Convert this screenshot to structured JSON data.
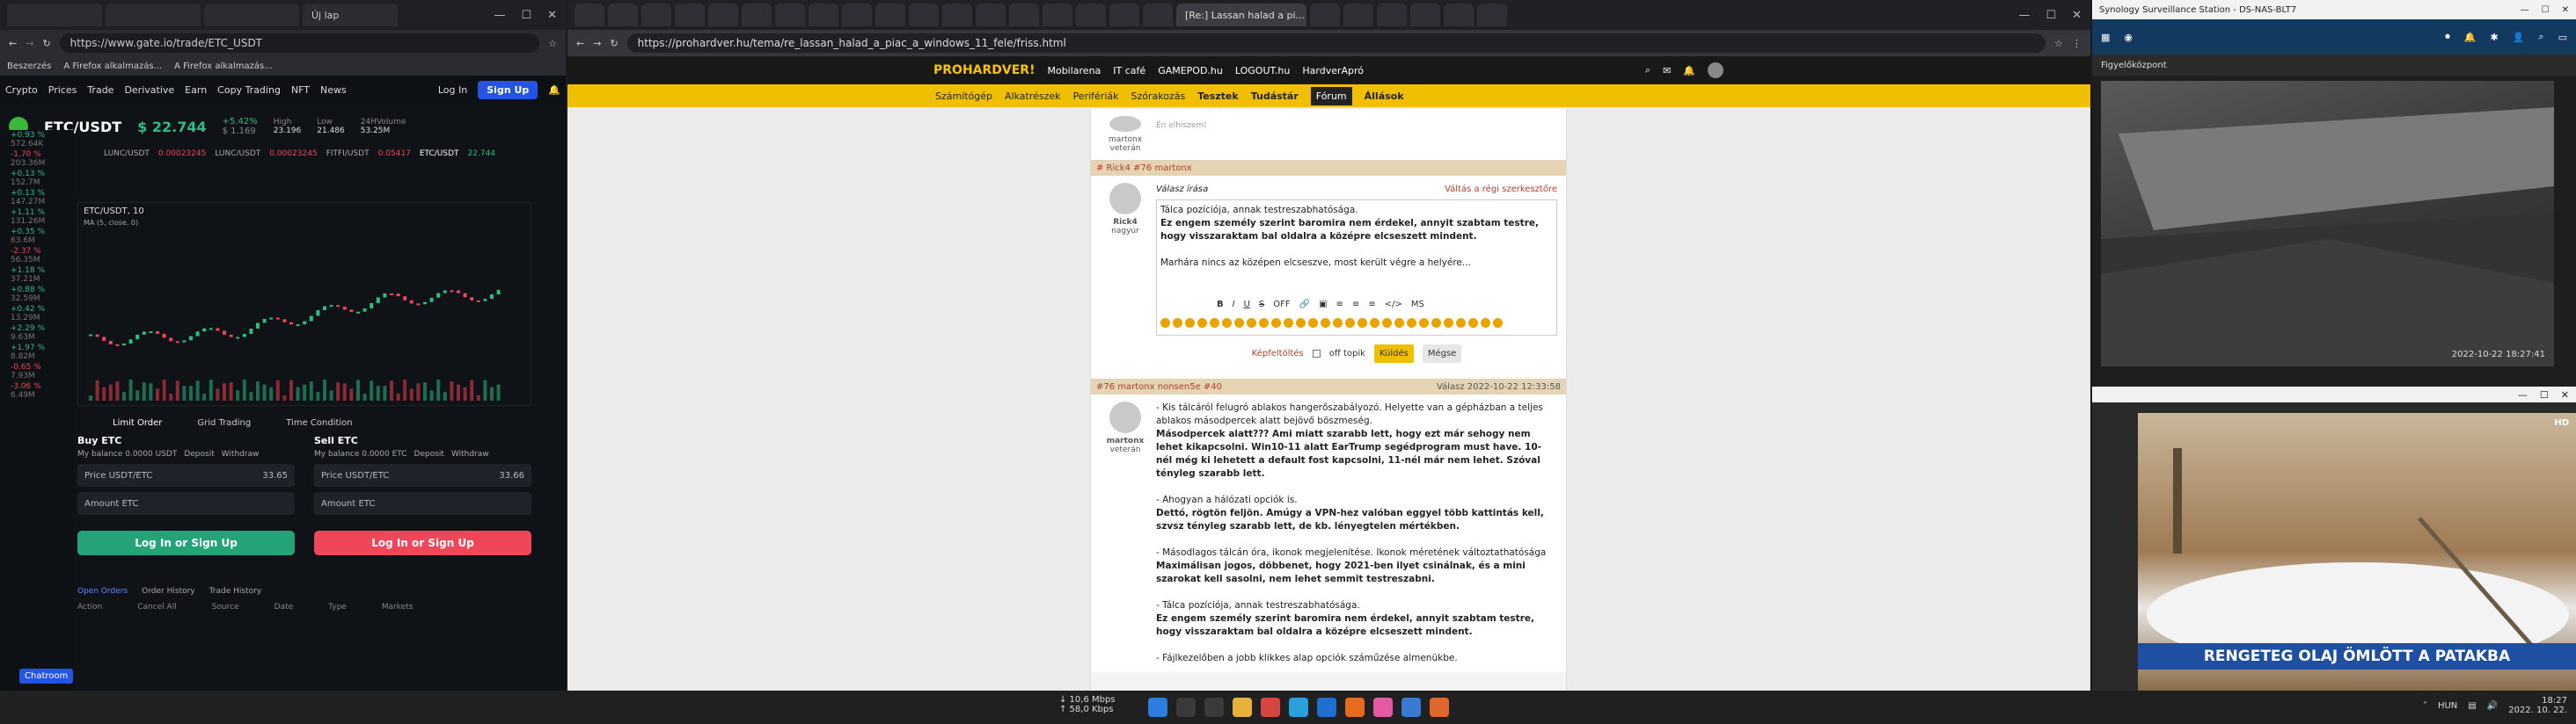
{
  "gate": {
    "tabs": [
      "",
      "",
      "",
      "Új lap",
      "",
      ""
    ],
    "url": "https://www.gate.io/trade/ETC_USDT",
    "bookmarks": [
      "Beszerzés",
      "A Firefox alkalmazás...",
      "A Firefox alkalmazás..."
    ],
    "nav": [
      "Crypto",
      "Prices",
      "Trade",
      "Derivative",
      "Earn",
      "Copy Trading",
      "NFT",
      "News"
    ],
    "login": "Log In",
    "signup": "Sign Up",
    "pair": "ETC/USDT",
    "price": "$ 22.744",
    "change": "+5.42%",
    "price_usd": "$ 1.169",
    "high_label": "High",
    "high": "23.196",
    "low_label": "Low",
    "low": "21.486",
    "vol_label": "24HVolume",
    "vol": "53.25M",
    "subtabs": [
      "LUNC/USDT",
      "0.00023245",
      "LUNC/USDT",
      "0.00023245",
      "FITFI/USDT",
      "0.05417",
      "ETC/USDT",
      "22.744"
    ],
    "chart_title": "ETC/USDT, 10",
    "ma": "MA (5, close, 0)",
    "buy_title": "Buy ETC",
    "sell_title": "Sell ETC",
    "balance_buy": "My balance 0.0000 USDT",
    "balance_sell": "My balance 0.0000 ETC",
    "deposit": "Deposit",
    "withdraw": "Withdraw",
    "price_field": "Price USDT/ETC",
    "price_val": "33.65",
    "price_val_sell": "33.66",
    "amount_field": "Amount ETC",
    "login_or_signup": "Log In or Sign Up",
    "limit_order": "Limit Order",
    "grid_trading": "Grid Trading",
    "time_condition": "Time Condition",
    "open_orders": "Open Orders",
    "order_history": "Order History",
    "trade_history": "Trade History",
    "cols": [
      "Action",
      "Cancel All",
      "Source",
      "Date",
      "Type",
      "Markets"
    ],
    "chatroom": "Chatroom",
    "left_list": [
      {
        "name": "+0.93 %",
        "vol": "572.64K"
      },
      {
        "name": "-1.70 %",
        "vol": "203.36M"
      },
      {
        "name": "+0.13 %",
        "vol": "152.7M"
      },
      {
        "name": "+0.13 %",
        "vol": "147.27M"
      },
      {
        "name": "+1.11 %",
        "vol": "131.26M"
      },
      {
        "name": "+0.35 %",
        "vol": "63.6M"
      },
      {
        "name": "-2.37 %",
        "vol": "56.35M"
      },
      {
        "name": "+1.18 %",
        "vol": "37.21M"
      },
      {
        "name": "+0.88 %",
        "vol": "32.59M"
      },
      {
        "name": "+0.42 %",
        "vol": "13.29M"
      },
      {
        "name": "+2.29 %",
        "vol": "9.63M"
      },
      {
        "name": "+1.97 %",
        "vol": "8.82M"
      },
      {
        "name": "-0.65 %",
        "vol": "7.93M"
      },
      {
        "name": "-3.06 %",
        "vol": "6.49M"
      }
    ]
  },
  "ph": {
    "active_tab": "[Re:] Lassan halad a pi...",
    "url": "https://prohardver.hu/tema/re_lassan_halad_a_piac_a_windows_11_fele/friss.html",
    "logo": "PROHARDVER!",
    "topnav": [
      "Mobilarena",
      "IT café",
      "GAMEPOD.hu",
      "LOGOUT.hu",
      "HardverApró"
    ],
    "nav": [
      "Számítógép",
      "Alkatrészek",
      "Perifériák",
      "Szórakozás",
      "Tesztek",
      "Tudástár",
      "Fórum",
      "Állások"
    ],
    "prev_user": "martonx",
    "prev_rank": "veterán",
    "prev_text": "Én elhiszem!",
    "reply_bar": "# Rick4   #76 martonx",
    "reply_label": "Válasz írása",
    "editor_switch": "Váltás a régi szerkesztőre",
    "reply_user": "Rick4",
    "reply_rank": "nagyúr",
    "reply_lines": [
      "Tálca pozíciója, annak testreszabhatósága.",
      "Ez engem személy szerint baromira nem érdekel, annyit szabtam testre, hogy visszaraktam bal oldalra a középre elcseszett mindent.",
      "",
      "Marhára nincs az középen elcseszve, most került végre a helyére..."
    ],
    "toolbar": [
      "B",
      "I",
      "U",
      "S",
      "OFF",
      "MS"
    ],
    "upload": "Képfeltöltés",
    "offtopic": "off topik",
    "send": "Küldés",
    "cancel": "Mégse",
    "post_bar": "#76 martonx   nonsen5e #40",
    "post_meta": "Válasz   2022-10-22 12:33:58",
    "post_user": "martonx",
    "post_rank": "veterán",
    "post_lines": [
      {
        "t": "- Kis tálcáról felugró ablakos hangerőszabályozó. Helyette van a gépházban a teljes ablakos másodpercek alatt bejövő böszmeség.",
        "b": false
      },
      {
        "t": "Másodpercek alatt??? Ami miatt szarabb lett, hogy ezt már sehogy nem lehet kikapcsolni. Win10-11 alatt EarTrump segédprogram must have. 10-nél még ki lehetett a default fost kapcsolni, 11-nél már nem lehet. Szóval tényleg szarabb lett.",
        "b": true
      },
      {
        "t": "",
        "b": false
      },
      {
        "t": "- Ahogyan a hálózati opciók is.",
        "b": false
      },
      {
        "t": "Dettó, rögtön feljön. Amúgy a VPN-hez valóban eggyel több kattintás kell, szvsz tényleg szarabb lett, de kb. lényegtelen mértékben.",
        "b": true
      },
      {
        "t": "",
        "b": false
      },
      {
        "t": "- Másodlagos tálcán óra, ikonok megjelenítése. Ikonok méretének változtathatósága",
        "b": false
      },
      {
        "t": "Maximálisan jogos, döbbenet, hogy 2021-ben ilyet csinálnak, és a mini szarokat kell sasolni, nem lehet semmit testreszabni.",
        "b": true
      },
      {
        "t": "",
        "b": false
      },
      {
        "t": "- Tálca pozíciója, annak testreszabhatósága.",
        "b": false
      },
      {
        "t": "Ez engem személy szerint baromira nem érdekel, annyit szabtam testre, hogy visszaraktam bal oldalra a középre elcseszett mindent.",
        "b": true
      },
      {
        "t": "",
        "b": false
      },
      {
        "t": "- Fájlkezelőben a jobb klikkes alap opciók száműzése almenükbe.",
        "b": false
      }
    ]
  },
  "syn": {
    "title": "Synology Surveillance Station - DS-NAS-BLT7",
    "panel": "Figyelőközpont",
    "cam_time": "2022-10-22  18:27:41"
  },
  "news": {
    "ticker": "RENGETEG OLAJ ÖMLÖTT A PATAKBA",
    "channel": "HD"
  },
  "taskbar": {
    "net_down": "↓ 10,6 Mbps",
    "net_up": "↑ 58,0 Kbps",
    "lang": "HUN",
    "time": "18:27",
    "date": "2022. 10. 22."
  },
  "colors": {
    "gate_green": "#2dbd85",
    "gate_red": "#f0465a",
    "gate_blue": "#2354e6",
    "ph_yellow": "#f0c000"
  }
}
